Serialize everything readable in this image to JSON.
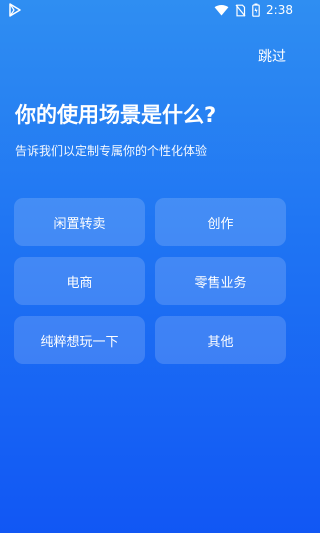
{
  "status_bar": {
    "time": "2:38",
    "left_icon": "play-icon",
    "icons": [
      "wifi-icon",
      "sim-off-icon",
      "battery-icon"
    ]
  },
  "header": {
    "skip_label": "跳过"
  },
  "main": {
    "title": "你的使用场景是什么?",
    "subtitle": "告诉我们以定制专属你的个性化体验"
  },
  "options": [
    {
      "label": "闲置转卖"
    },
    {
      "label": "创作"
    },
    {
      "label": "电商"
    },
    {
      "label": "零售业务"
    },
    {
      "label": "纯粹想玩一下"
    },
    {
      "label": "其他"
    }
  ],
  "colors": {
    "background_top": "#2f8ef2",
    "background_bottom": "#1157f4",
    "option_background": "rgba(255,255,255,0.16)",
    "text": "#ffffff"
  }
}
